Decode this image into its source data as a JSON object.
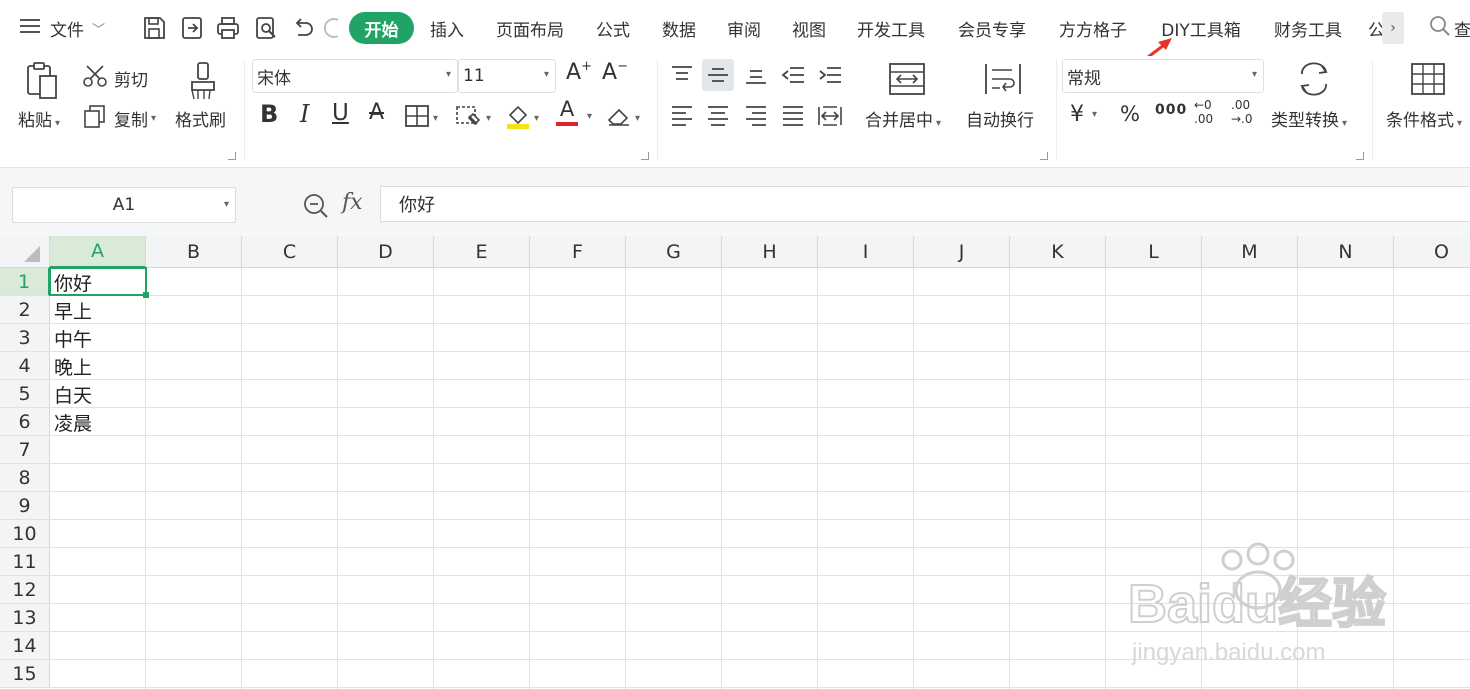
{
  "menubar": {
    "file_label": "文件",
    "tabs": [
      {
        "label": "开始",
        "active": true
      },
      {
        "label": "插入"
      },
      {
        "label": "页面布局"
      },
      {
        "label": "公式"
      },
      {
        "label": "数据"
      },
      {
        "label": "审阅"
      },
      {
        "label": "视图"
      },
      {
        "label": "开发工具"
      },
      {
        "label": "会员专享"
      },
      {
        "label": "方方格子"
      },
      {
        "label": "DIY工具箱"
      },
      {
        "label": "财务工具"
      }
    ],
    "overflow_partial": "公",
    "search_partial": "查"
  },
  "ribbon": {
    "paste_label": "粘贴",
    "cut_label": "剪切",
    "copy_label": "复制",
    "format_painter_label": "格式刷",
    "font_name": "宋体",
    "font_size": "11",
    "merge_label": "合并居中",
    "wrap_label": "自动换行",
    "number_format": "常规",
    "currency_symbol": "¥",
    "percent_symbol": "%",
    "thousands_symbol": "000",
    "inc_decimal_top": "←0",
    "inc_decimal_bottom": ".00",
    "dec_decimal_top": ".00",
    "dec_decimal_bottom": "→.0",
    "type_convert_label": "类型转换",
    "conditional_format_label": "条件格式",
    "bold": "B",
    "italic": "I",
    "underline": "U",
    "strike": "A",
    "font_color_letter": "A",
    "font_grow": "A",
    "font_shrink": "A"
  },
  "formula_bar": {
    "cell_ref": "A1",
    "fx_label": "fx",
    "value": "你好"
  },
  "sheet": {
    "columns": [
      "A",
      "B",
      "C",
      "D",
      "E",
      "F",
      "G",
      "H",
      "I",
      "J",
      "K",
      "L",
      "M",
      "N",
      "O"
    ],
    "rows": [
      "1",
      "2",
      "3",
      "4",
      "5",
      "6",
      "7",
      "8",
      "9",
      "10",
      "11",
      "12",
      "13",
      "14",
      "15"
    ],
    "cells_A": [
      "你好",
      "早上",
      "中午",
      "晚上",
      "白天",
      "凌晨"
    ]
  },
  "watermark": {
    "brand": "Baidu经验",
    "url": "jingyan.baidu.com"
  },
  "colors": {
    "accent": "#21a366",
    "arrow": "#e8332a"
  }
}
